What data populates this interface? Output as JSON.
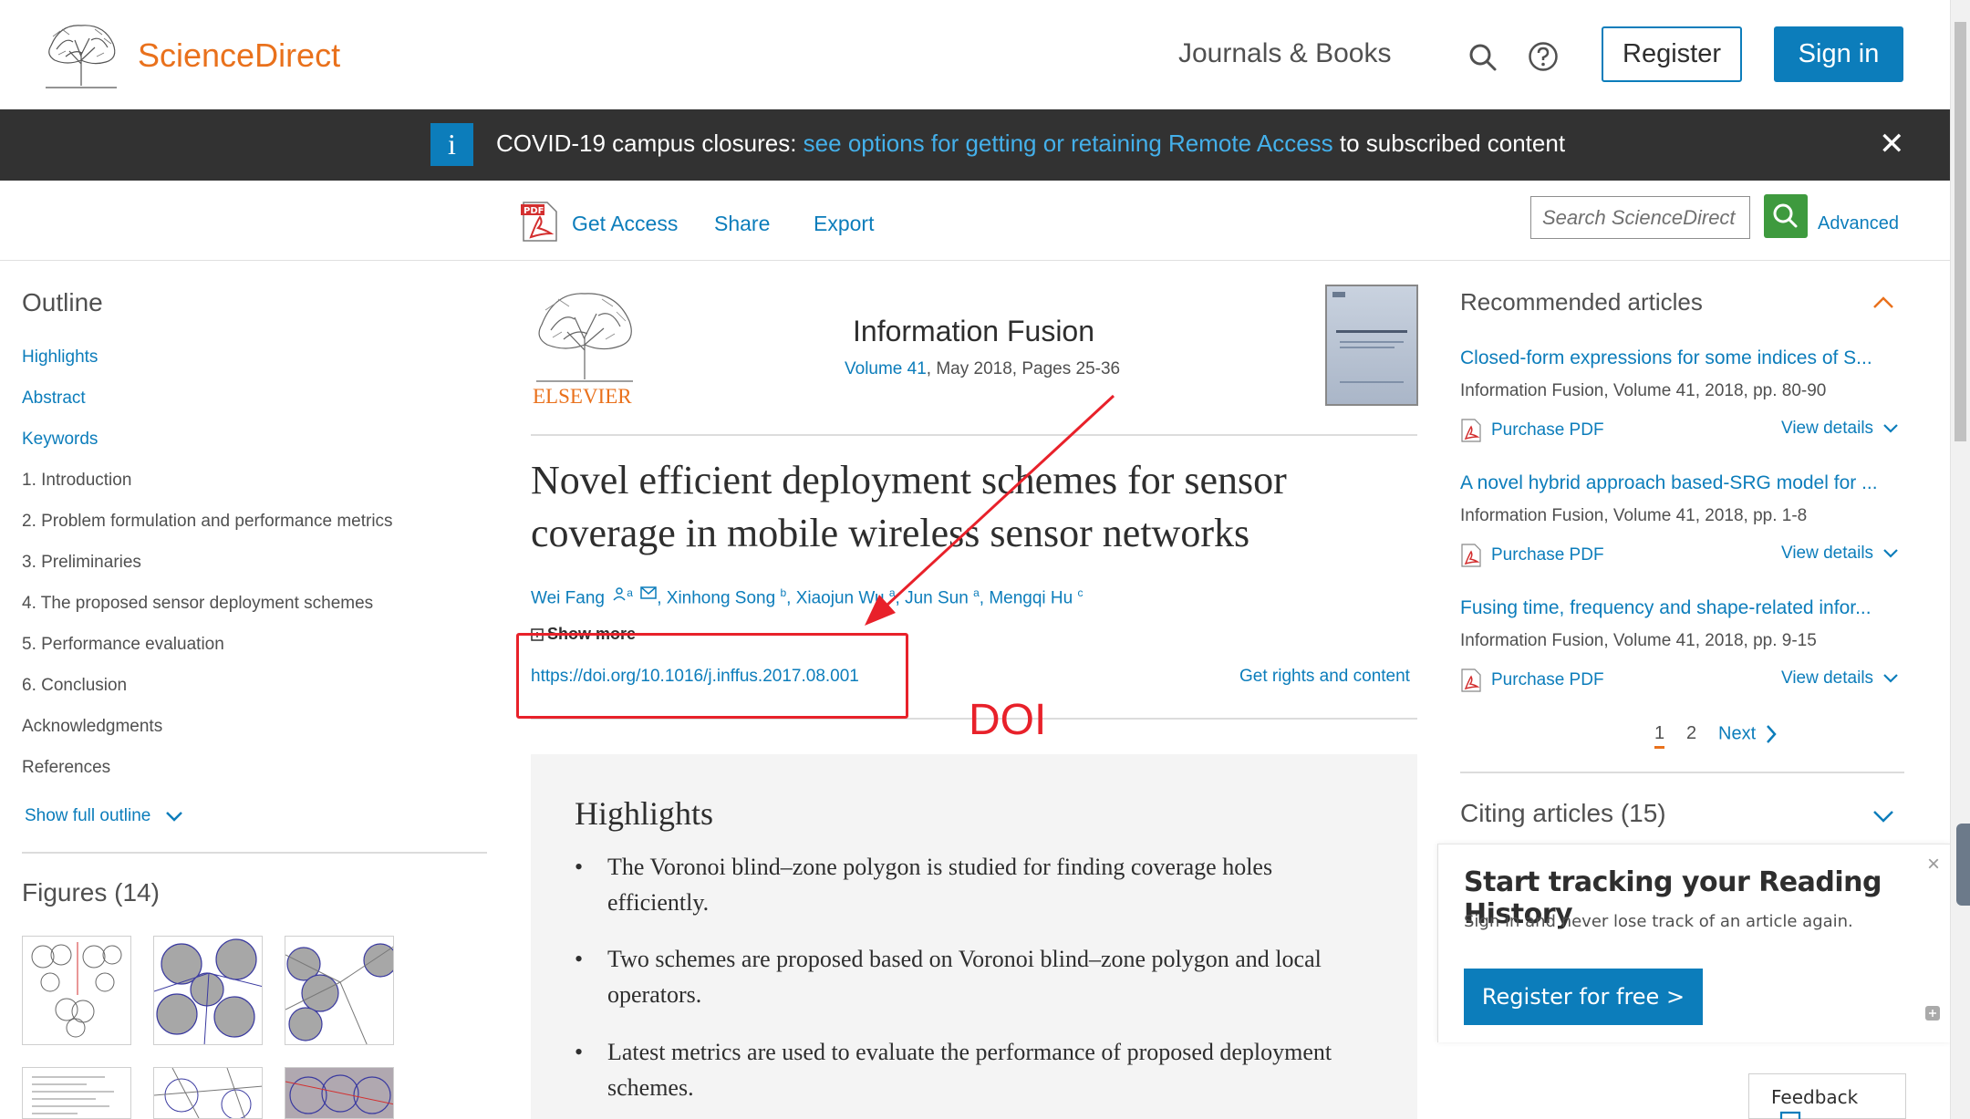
{
  "header": {
    "brand": "ScienceDirect",
    "nav_journals": "Journals & Books",
    "register_label": "Register",
    "signin_label": "Sign in"
  },
  "banner": {
    "info_glyph": "i",
    "prefix": "COVID-19 campus closures: ",
    "link_text": "see options for getting or retaining Remote Access",
    "suffix": " to subscribed content",
    "close_glyph": "✕"
  },
  "toolbar": {
    "get_access": "Get Access",
    "share": "Share",
    "export": "Export",
    "search_placeholder": "Search ScienceDirect",
    "advanced": "Advanced"
  },
  "outline": {
    "title": "Outline",
    "items": [
      {
        "label": "Highlights",
        "link": true
      },
      {
        "label": "Abstract",
        "link": true
      },
      {
        "label": "Keywords",
        "link": true
      },
      {
        "label": "1. Introduction",
        "link": false
      },
      {
        "label": "2. Problem formulation and performance metrics",
        "link": false
      },
      {
        "label": "3. Preliminaries",
        "link": false
      },
      {
        "label": "4. The proposed sensor deployment schemes",
        "link": false
      },
      {
        "label": "5. Performance evaluation",
        "link": false
      },
      {
        "label": "6. Conclusion",
        "link": false
      },
      {
        "label": "Acknowledgments",
        "link": false
      },
      {
        "label": "References",
        "link": false
      }
    ],
    "show_full": "Show full outline"
  },
  "figures": {
    "title": "Figures (14)"
  },
  "article": {
    "publisher": "ELSEVIER",
    "journal_title": "Information Fusion",
    "volume_link": "Volume 41",
    "volume_rest": ", May 2018, Pages 25-36",
    "title": "Novel efficient deployment schemes for sensor coverage in mobile wireless sensor networks",
    "authors": [
      {
        "name": "Wei Fang",
        "sup": "a"
      },
      {
        "name": "Xinhong Song",
        "sup": "b"
      },
      {
        "name": "Xiaojun Wu",
        "sup": "a"
      },
      {
        "name": "Jun Sun",
        "sup": "a"
      },
      {
        "name": "Mengqi Hu",
        "sup": "c"
      }
    ],
    "show_more": "Show more",
    "doi": "https://doi.org/10.1016/j.inffus.2017.08.001",
    "rights": "Get rights and content",
    "highlights_title": "Highlights",
    "highlights": [
      "The Voronoi blind–zone polygon is studied for finding coverage holes efficiently.",
      "Two schemes are proposed based on Voronoi blind–zone polygon and local operators.",
      "Latest metrics are used to evaluate the performance of proposed deployment schemes."
    ]
  },
  "annotation": {
    "label": "DOI",
    "color": "#e8212a"
  },
  "recommended": {
    "title": "Recommended articles",
    "items": [
      {
        "title": "Closed-form expressions for some indices of S...",
        "meta": "Information Fusion, Volume 41, 2018, pp. 80-90",
        "pdf": "Purchase PDF",
        "view": "View details"
      },
      {
        "title": "A novel hybrid approach based-SRG model for ...",
        "meta": "Information Fusion, Volume 41, 2018, pp. 1-8",
        "pdf": "Purchase PDF",
        "view": "View details"
      },
      {
        "title": "Fusing time, frequency and shape-related infor...",
        "meta": "Information Fusion, Volume 41, 2018, pp. 9-15",
        "pdf": "Purchase PDF",
        "view": "View details"
      }
    ],
    "pages": [
      "1",
      "2"
    ],
    "next": "Next",
    "current_page": 1
  },
  "citing": {
    "title": "Citing articles (15)"
  },
  "popup": {
    "title": "Start tracking your Reading History",
    "subtitle": "Sign in and never lose track of an article again.",
    "button": "Register for free >",
    "close": "×"
  },
  "feedback": {
    "label": "Feedback"
  },
  "colors": {
    "brand": "#e9711c",
    "link": "#0c7dbb",
    "banner_bg": "#323232",
    "search_btn": "#3e9a3e"
  }
}
